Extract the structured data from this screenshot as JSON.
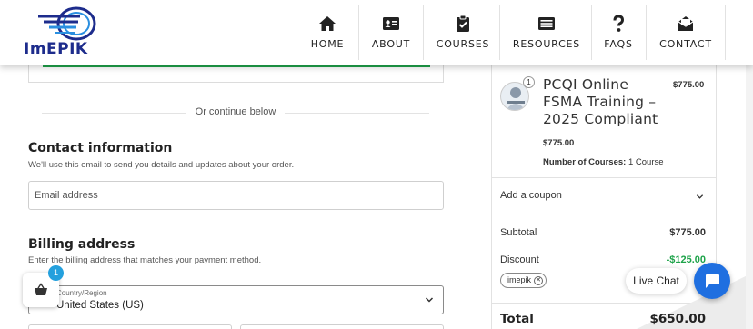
{
  "brand": {
    "logo_text": "ImEPIK"
  },
  "nav": {
    "items": [
      {
        "label": "HOME",
        "icon": "home-icon"
      },
      {
        "label": "ABOUT",
        "icon": "id-card-icon"
      },
      {
        "label": "COURSES",
        "icon": "clipboard-check-icon"
      },
      {
        "label": "RESOURCES",
        "icon": "newspaper-icon"
      },
      {
        "label": "FAQS",
        "icon": "question-icon"
      },
      {
        "label": "CONTACT",
        "icon": "envelope-open-icon"
      }
    ]
  },
  "checkout": {
    "continue_text": "Or continue below",
    "contact": {
      "title": "Contact information",
      "subtitle": "We'll use this email to send you details and updates about your order.",
      "email_placeholder": "Email address"
    },
    "billing": {
      "title": "Billing address",
      "subtitle": "Enter the billing address that matches your payment method.",
      "country_label": "Country/Region",
      "country_value": "United States (US)"
    }
  },
  "cart": {
    "count": "1"
  },
  "order_summary": {
    "product": {
      "title": "PCQI Online FSMA Training – 2025 Compliant",
      "quantity": "1",
      "price": "$775.00",
      "unit_price": "$775.00",
      "meta_label": "Number of Courses:",
      "meta_value": "1 Course"
    },
    "coupon_label": "Add a coupon",
    "subtotal_label": "Subtotal",
    "subtotal_value": "$775.00",
    "discount_label": "Discount",
    "discount_value": "-$125.00",
    "coupon_code": "imepik",
    "total_label": "Total",
    "total_value": "$650.00"
  },
  "live_chat": {
    "label": "Live Chat"
  },
  "colors": {
    "accent_green": "#1ea34a",
    "brand_blue": "#1d2c8c",
    "chat_blue": "#1f6fe0",
    "badge_blue": "#24a0dd"
  }
}
